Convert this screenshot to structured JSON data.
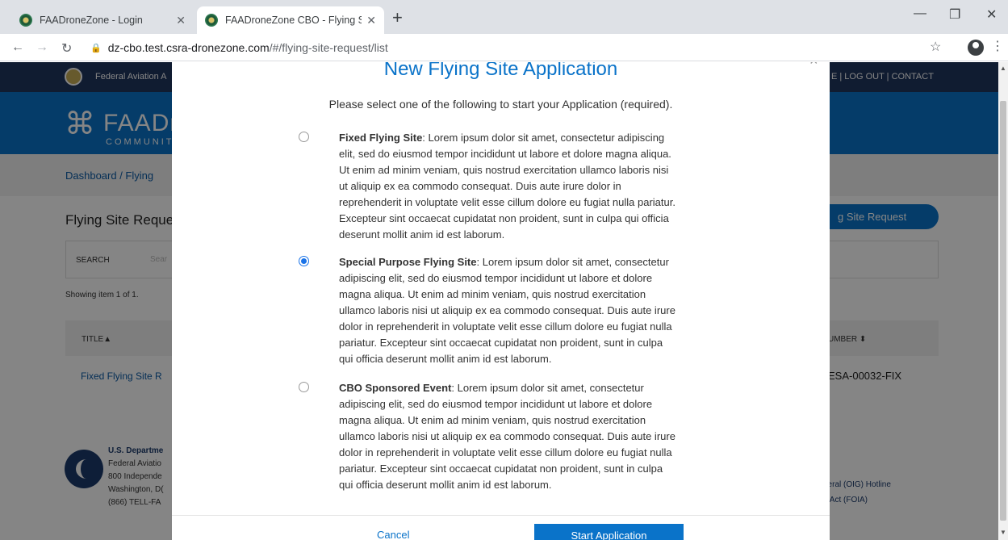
{
  "browser": {
    "tabs": [
      {
        "title": "FAADroneZone - Login"
      },
      {
        "title": "FAADroneZone CBO - Flying Site"
      }
    ],
    "url_host": "dz-cbo.test.csra-dronezone.com",
    "url_path": "/#/flying-site-request/list"
  },
  "background_page": {
    "gov_name": "Federal Aviation A",
    "top_links": "E | LOG OUT | CONTACT",
    "brand_name": "FAADr",
    "brand_sub": "COMMUNIT",
    "breadcrumb": "Dashboard  /  Flying",
    "page_title": "Flying Site Reque",
    "new_request_button": "g Site Request",
    "search_label": "SEARCH",
    "search_placeholder": "Sear",
    "showing": "Showing item 1 of 1.",
    "col_title": "TITLE▲",
    "col_number": "UMBER ⬍",
    "row_title": "Fixed Flying Site R",
    "row_number": "ESA-00032-FIX",
    "footer_org": "U.S. Departme",
    "footer_lines": [
      "Federal Aviatio",
      "800 Independe",
      "Washington, D(",
      "(866) TELL-FA"
    ],
    "footer_link_1": "neral (OIG) Hotline",
    "footer_link_2": "n Act (FOIA)"
  },
  "modal": {
    "title": "New Flying Site Application",
    "subtitle": "Please select one of the following to start your Application (required).",
    "options": [
      {
        "label": "Fixed Flying Site",
        "text": ": Lorem ipsum dolor sit amet, consectetur adipiscing elit, sed do eiusmod tempor incididunt ut labore et dolore magna aliqua. Ut enim ad minim veniam, quis nostrud exercitation ullamco laboris nisi ut aliquip ex ea commodo consequat. Duis aute irure dolor in reprehenderit in voluptate velit esse cillum dolore eu fugiat nulla pariatur. Excepteur sint occaecat cupidatat non proident, sunt in culpa qui officia deserunt mollit anim id est laborum.",
        "selected": false
      },
      {
        "label": "Special Purpose Flying Site",
        "text": ": Lorem ipsum dolor sit amet, consectetur adipiscing elit, sed do eiusmod tempor incididunt ut labore et dolore magna aliqua. Ut enim ad minim veniam, quis nostrud exercitation ullamco laboris nisi ut aliquip ex ea commodo consequat. Duis aute irure dolor in reprehenderit in voluptate velit esse cillum dolore eu fugiat nulla pariatur. Excepteur sint occaecat cupidatat non proident, sunt in culpa qui officia deserunt mollit anim id est laborum.",
        "selected": true
      },
      {
        "label": "CBO Sponsored Event",
        "text": ": Lorem ipsum dolor sit amet, consectetur adipiscing elit, sed do eiusmod tempor incididunt ut labore et dolore magna aliqua. Ut enim ad minim veniam, quis nostrud exercitation ullamco laboris nisi ut aliquip ex ea commodo consequat. Duis aute irure dolor in reprehenderit in voluptate velit esse cillum dolore eu fugiat nulla pariatur. Excepteur sint occaecat cupidatat non proident, sunt in culpa qui officia deserunt mollit anim id est laborum.",
        "selected": false
      }
    ],
    "cancel_label": "Cancel",
    "start_label": "Start Application"
  },
  "colors": {
    "accent": "#0a73c9",
    "gov_bar": "#20365f"
  },
  "icons": [
    "favicon-icon",
    "close-icon",
    "plus-icon",
    "minimize-icon",
    "restore-icon",
    "back-icon",
    "forward-icon",
    "reload-icon",
    "lock-icon",
    "star-icon",
    "profile-icon",
    "menu-icon"
  ]
}
